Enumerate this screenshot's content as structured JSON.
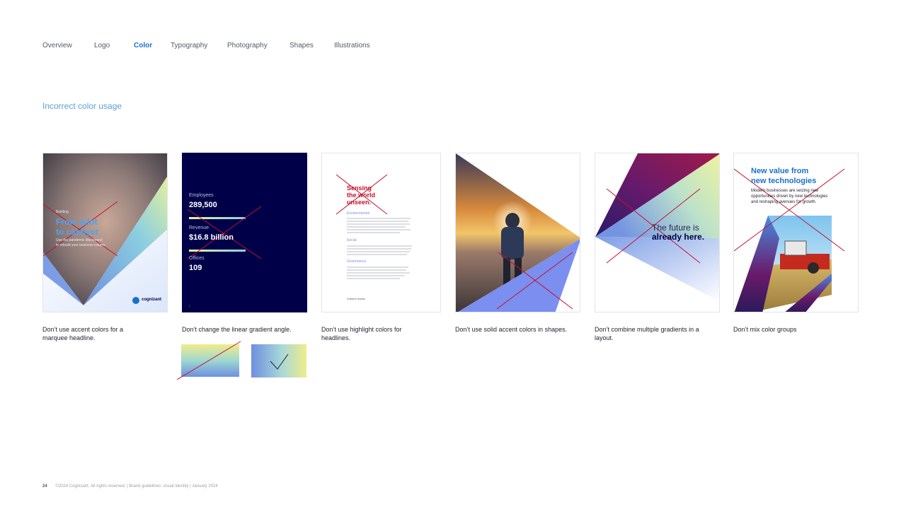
{
  "nav": {
    "items": [
      "Overview",
      "Logo",
      "Color",
      "Typography",
      "Photography",
      "Shapes",
      "Illustrations"
    ],
    "active": "Color"
  },
  "section_title": "Incorrect color usage",
  "cards": {
    "c1": {
      "caption": "Don’t use accent colors for a marquee headline.",
      "small": "Building",
      "headline_1": "From pilot",
      "headline_2": "to catalyst",
      "body_1": "Use the pandemic disconnect",
      "body_2": "to rebuild your business returns",
      "logo": "cognizant"
    },
    "c2": {
      "caption": "Don’t change the linear gradient angle.",
      "stats": [
        {
          "label": "Employees",
          "value": "289,500"
        },
        {
          "label": "Revenue",
          "value": "$16.8 billion"
        },
        {
          "label": "Offices",
          "value": "109"
        }
      ]
    },
    "c3": {
      "caption": "Don’t use highlight colors for headlines.",
      "headline_1": "Sensing",
      "headline_2": "the world",
      "headline_3": "unseen.",
      "sections": [
        "Environmental",
        "Social",
        "Governance"
      ],
      "footer_note": "Subtext reader"
    },
    "c4": {
      "caption": "Don’t use solid accent colors in shapes."
    },
    "c5": {
      "caption": "Don’t combine multiple gradients in a layout.",
      "line_1": "The future is",
      "line_2": "already here."
    },
    "c6": {
      "caption": "Don’t mix color groups",
      "headline_1": "New value from",
      "headline_2": "new technologies",
      "body_1": "Modern businesses are seizing new",
      "body_2": "opportunities driven by new technologies",
      "body_3": "and reshaping avenues for growth."
    }
  },
  "footer": {
    "page": "24",
    "text": "©2024 Cognizant. All rights reserved.  |  Brand guidelines: visual identity  |  January 2024"
  },
  "colors": {
    "error_line": "#c8102e",
    "navy": "#000048",
    "accent_blue": "#1a6fd0",
    "highlight_red": "#c8102e",
    "periwinkle": "#7b8ff0"
  }
}
